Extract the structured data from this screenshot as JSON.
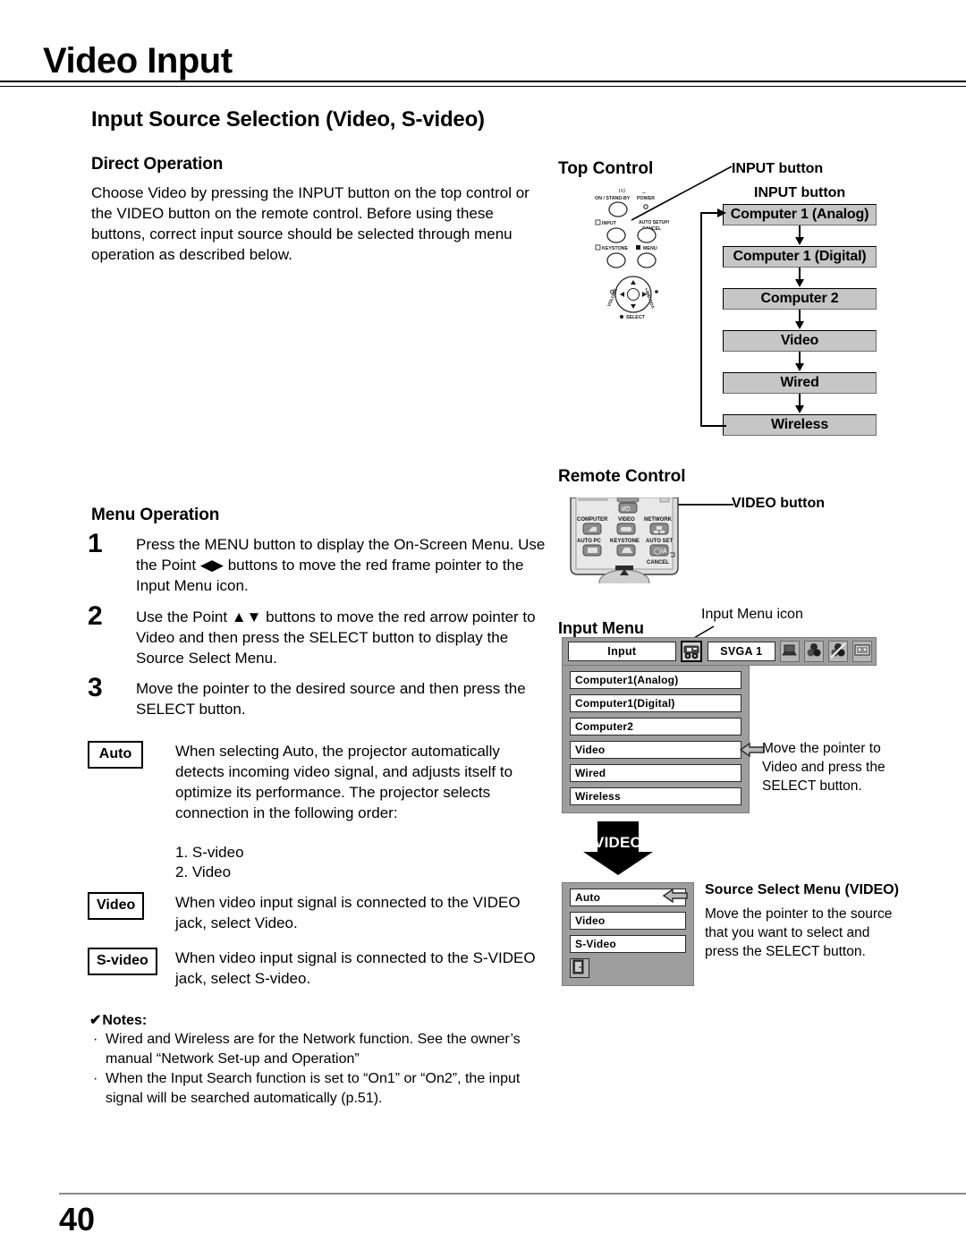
{
  "header": {
    "title": "Video Input"
  },
  "section": {
    "heading": "Input Source Selection (Video, S-video)"
  },
  "direct_operation": {
    "heading": "Direct Operation",
    "body": "Choose Video by pressing the INPUT button on the top control or the VIDEO button on the remote control. Before using these buttons, correct input source should be selected through menu operation as described below."
  },
  "menu_operation": {
    "heading": "Menu Operation",
    "steps": [
      {
        "num": "1",
        "text": "Press the MENU button to display the On-Screen Menu. Use the Point ◀▶ buttons to move the red frame pointer to the Input Menu icon."
      },
      {
        "num": "2",
        "text": "Use the Point ▲▼ buttons to move the red arrow pointer to Video and then press the SELECT button to display the Source Select Menu."
      },
      {
        "num": "3",
        "text": "Move the pointer to the desired source and then press the SELECT button."
      }
    ]
  },
  "definitions": [
    {
      "tag": "Auto",
      "text": "When selecting Auto, the projector automatically detects incoming video signal, and adjusts itself to optimize its performance. The projector selects connection in the following order:",
      "order": [
        "1. S-video",
        "2. Video"
      ]
    },
    {
      "tag": "Video",
      "text": "When video input signal is connected to the VIDEO jack, select Video."
    },
    {
      "tag": "S-video",
      "text": "When video input signal is connected to the S-VIDEO jack, select S-video."
    }
  ],
  "notes": {
    "title": "Notes:",
    "check_glyph": "✔",
    "bullet_glyph": "·",
    "items": [
      "Wired and Wireless are for the Network function. See the owner’s manual “Network Set-up and Operation”",
      "When the Input Search function is set to “On1” or “On2”, the input signal will be searched automatically (p.51)."
    ]
  },
  "top_control": {
    "heading": "Top Control",
    "callout": "INPUT button",
    "flow_heading": "INPUT button",
    "flow_steps": [
      "Computer 1 (Analog)",
      "Computer 1 (Digital)",
      "Computer 2",
      "Video",
      "Wired",
      "Wireless"
    ],
    "panel_labels": {
      "on_standby": "ON / STAND-BY",
      "power": "POWER",
      "input": "INPUT",
      "auto_setup": "AUTO SETUP/",
      "cancel": "CANCEL",
      "keystone": "KEYSTONE",
      "menu": "MENU",
      "volume_minus": "VOLUME–",
      "volume_plus": "VOLUME+",
      "select": "SELECT",
      "power_glyph": "I/⏻"
    }
  },
  "remote_control": {
    "heading": "Remote Control",
    "callout": "VIDEO button",
    "keys": {
      "computer": "COMPUTER",
      "video": "VIDEO",
      "network": "NETWORK",
      "auto_pc": "AUTO PC",
      "keystone": "KEYSTONE",
      "auto_set": "AUTO SET",
      "cancel": "CANCEL"
    }
  },
  "input_menu": {
    "heading": "Input Menu",
    "icon_callout": "Input Menu icon",
    "menubar": {
      "input_label": "Input",
      "signal_label": "SVGA 1",
      "icons": [
        "input-source-icon",
        "computer-icon",
        "color-adjust-icon",
        "sound-mute-icon",
        "screen-icon"
      ]
    },
    "sources": [
      "Computer1(Analog)",
      "Computer1(Digital)",
      "Computer2",
      "Video",
      "Wired",
      "Wireless"
    ],
    "pointer_target": "Video",
    "note": "Move the pointer to Video and press the SELECT button."
  },
  "video_arrow": {
    "label": "VIDEO"
  },
  "source_select": {
    "title": "Source Select Menu (VIDEO)",
    "body": "Move the pointer to the source that you want to select and press the SELECT button.",
    "options": [
      "Auto",
      "Video",
      "S-Video"
    ],
    "pointer_target": "Auto",
    "quit_icon": "quit-door-icon"
  },
  "footer": {
    "page_number": "40"
  },
  "colors": {
    "box_fill": "#c6c6c6",
    "osd_bg": "#9e9e9e",
    "osd_field": "#ffffff",
    "ink": "#000000",
    "footer_rule": "#8a8a8a"
  }
}
